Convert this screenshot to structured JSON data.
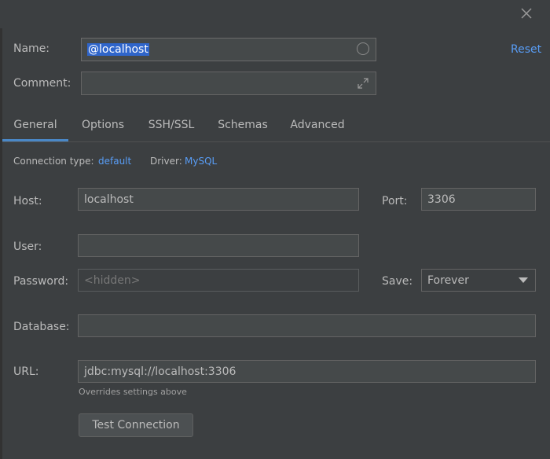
{
  "window": {
    "close_icon": "close-icon"
  },
  "form": {
    "name_label": "Name:",
    "name_value": "@localhost",
    "comment_label": "Comment:",
    "comment_value": "",
    "reset_label": "Reset"
  },
  "tabs": [
    {
      "label": "General",
      "active": true
    },
    {
      "label": "Options"
    },
    {
      "label": "SSH/SSL"
    },
    {
      "label": "Schemas"
    },
    {
      "label": "Advanced"
    }
  ],
  "connection": {
    "type_label": "Connection type:",
    "type_value": "default",
    "driver_label": "Driver:",
    "driver_value": "MySQL"
  },
  "general": {
    "host_label": "Host:",
    "host_value": "localhost",
    "port_label": "Port:",
    "port_value": "3306",
    "user_label": "User:",
    "user_value": "",
    "password_label": "Password:",
    "password_placeholder": "<hidden>",
    "save_label": "Save:",
    "save_value": "Forever",
    "database_label": "Database:",
    "database_value": "",
    "url_label": "URL:",
    "url_value": "jdbc:mysql://localhost:3306",
    "url_hint": "Overrides settings above",
    "test_button": "Test Connection"
  },
  "colors": {
    "background": "#3c3f41",
    "accent": "#589df6",
    "tab_underline": "#4a88c7",
    "selection": "#2f65ca"
  }
}
